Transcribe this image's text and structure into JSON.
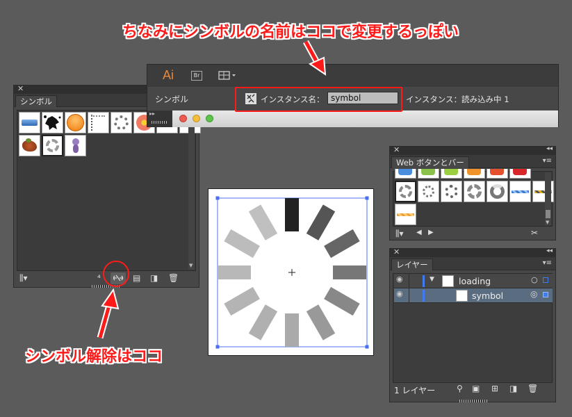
{
  "annotations": {
    "top_text": "ちなみにシンボルの名前はココで変更するっぽい",
    "bottom_text": "シンボル解除はココ"
  },
  "control_bar": {
    "ai_logo": "Ai",
    "br_button": "Br",
    "panel_label": "シンボル",
    "instance_name_label": "インスタンス名：",
    "instance_name_value": "symbol",
    "instance_status": "インスタンス：読み込み中 1"
  },
  "symbols_panel": {
    "tab": "シンボル",
    "items": [
      "blue-button",
      "ink-splat",
      "orange-circle",
      "dashed-line",
      "ring-ornament",
      "flower",
      "autumn-leaves",
      "loading-spinner",
      "cartoon-bug"
    ]
  },
  "web_panel": {
    "tab": "Web ボタンとバー"
  },
  "layers_panel": {
    "tab": "レイヤー",
    "rows": [
      {
        "name": "loading",
        "type": "layer",
        "selected": false
      },
      {
        "name": "symbol",
        "type": "sublayer",
        "selected": true
      }
    ],
    "footer_count": "1 レイヤー",
    "layer_color": "#3f7cf0"
  },
  "colors": {
    "annotation_red": "#ff1a1a",
    "selection_blue": "#4a6ff0"
  },
  "icons": {
    "break_link": "break-symbol-link-icon",
    "library": "symbol-library-icon",
    "place": "place-symbol-icon",
    "options": "symbol-options-icon",
    "new": "new-symbol-icon",
    "delete": "trash-icon"
  }
}
